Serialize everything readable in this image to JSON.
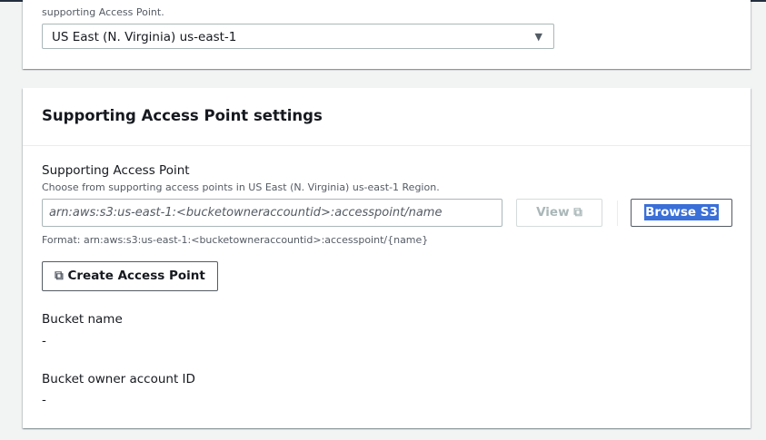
{
  "region_section": {
    "description_tail": "supporting Access Point.",
    "region_value": "US East (N. Virginia) us-east-1"
  },
  "settings": {
    "title": "Supporting Access Point settings",
    "ap_label": "Supporting Access Point",
    "ap_description": "Choose from supporting access points in US East (N. Virginia) us-east-1 Region.",
    "ap_placeholder": "arn:aws:s3:us-east-1:<bucketowneraccountid>:accesspoint/name",
    "view_label": "View",
    "browse_label": "Browse S3",
    "format_hint": "Format: arn:aws:s3:us-east-1:<bucketowneraccountid>:accesspoint/{name}",
    "create_label": "Create Access Point",
    "bucket_name_label": "Bucket name",
    "bucket_name_value": "-",
    "owner_label": "Bucket owner account ID",
    "owner_value": "-"
  }
}
